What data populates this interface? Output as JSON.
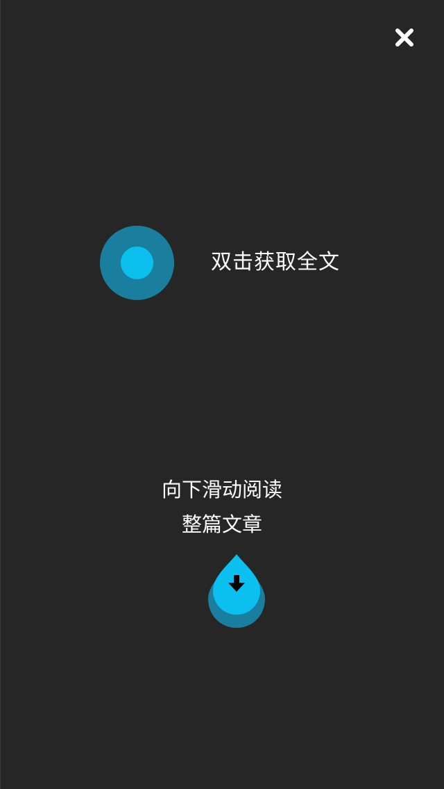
{
  "overlay": {
    "close_icon": "close-icon",
    "double_tap_hint": "双击获取全文",
    "swipe_hint_line1": "向下滑动阅读",
    "swipe_hint_line2": "整篇文章",
    "drop_icon": "water-drop-down-arrow-icon"
  },
  "colors": {
    "background": "#262626",
    "accent": "#0bbfee",
    "accent_dark": "#1a7f9e",
    "text": "#ffffff"
  }
}
